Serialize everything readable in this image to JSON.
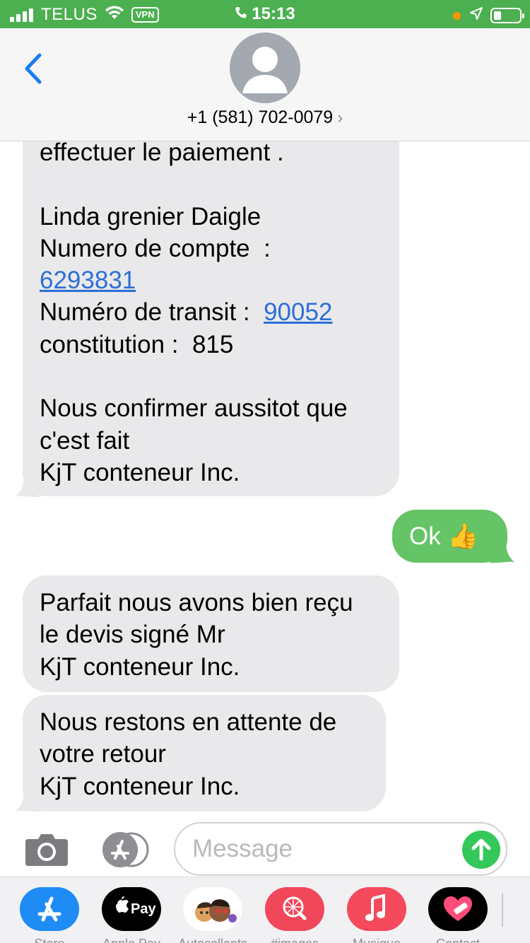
{
  "status_bar": {
    "carrier": "TELUS",
    "vpn": "VPN",
    "time": "15:13"
  },
  "header": {
    "contact": "+1 (581) 702-0079"
  },
  "messages": [
    {
      "from": "contact",
      "lines": {
        "l1": "effectuer le paiement .",
        "l2": "Linda grenier Daigle",
        "l3": "Numero de compte  :",
        "l4_link": "6293831",
        "l5_prefix": "Numéro de transit :  ",
        "l5_link": "90052",
        "l6": "constitution :  815",
        "l7": "Nous confirmer aussitot que",
        "l8": "c'est fait",
        "l9": "KjT conteneur Inc."
      }
    },
    {
      "from": "me",
      "text": "Ok 👍"
    },
    {
      "from": "contact",
      "lines": {
        "l1": "Parfait nous avons bien reçu",
        "l2": "le devis signé Mr",
        "l3": "KjT conteneur Inc."
      }
    },
    {
      "from": "contact",
      "lines": {
        "l1": "Nous restons en attente de",
        "l2": "votre retour",
        "l3": "KjT conteneur Inc."
      }
    }
  ],
  "input": {
    "placeholder": "Message"
  },
  "app_drawer": {
    "apps": [
      {
        "label": "Store",
        "icon": "app-store-icon",
        "color": "#1f8cf5"
      },
      {
        "label": "Apple Pay",
        "icon": "apple-pay-icon",
        "color": "#000000"
      },
      {
        "label": "Autocollants",
        "icon": "memoji-icon",
        "color": "#ffffff"
      },
      {
        "label": "#images",
        "icon": "images-search-icon",
        "color": "#f0475a"
      },
      {
        "label": "Musique",
        "icon": "music-icon",
        "color": "#f44a5c"
      },
      {
        "label": "Contact",
        "icon": "heart-contact-icon",
        "color": "#000000"
      }
    ]
  },
  "colors": {
    "status_bar": "#4caf50",
    "received_bubble": "#e9e9eb",
    "sent_bubble": "#65c466",
    "link": "#2d6ed8",
    "back_chevron": "#1a7cf5"
  }
}
